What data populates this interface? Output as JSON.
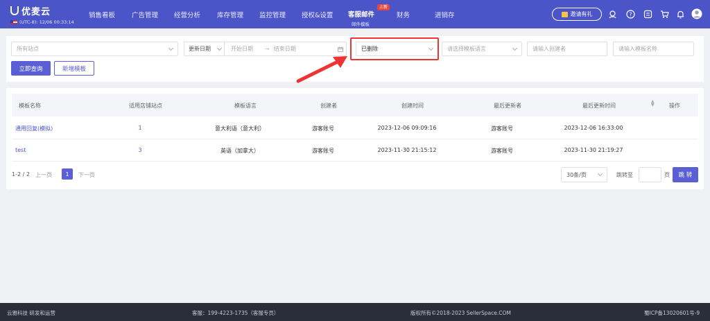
{
  "brand": {
    "name": "优麦云",
    "clock": "(UTC-8): 12/06 00:33:14"
  },
  "nav": {
    "items": [
      "销售看板",
      "广告管理",
      "经营分析",
      "库存管理",
      "监控管理",
      "授权&设置",
      "客服邮件",
      "财务",
      "进销存"
    ],
    "active_sub": "邮件模板",
    "new_badge": "上新",
    "invite": "邀请有礼"
  },
  "filters": {
    "site_placeholder": "所有站点",
    "date_type": "更新日期",
    "start_date": "开始日期",
    "end_date": "结束日期",
    "date_sep": "→",
    "status": "已删除",
    "language_placeholder": "请选择模板语言",
    "creator_placeholder": "请输入创建者",
    "template_name_placeholder": "请输入模板名称",
    "query_button": "立即查询",
    "add_button": "新增模板"
  },
  "table": {
    "columns": [
      "模板名称",
      "适用店铺站点",
      "模板语言",
      "创建者",
      "创建时间",
      "最后更新者",
      "最后更新时间",
      "操作"
    ],
    "rows": [
      {
        "name": "通用回复(模拟)",
        "sites": "1",
        "language": "意大利语（意大利）",
        "creator": "游客账号",
        "created": "2023-12-06 09:09:16",
        "updater": "游客账号",
        "updated": "2023-12-06 16:33:00"
      },
      {
        "name": "test",
        "sites": "3",
        "language": "英语（加拿大）",
        "creator": "游客账号",
        "created": "2023-11-30 21:15:12",
        "updater": "游客账号",
        "updated": "2023-11-30 21:19:27"
      }
    ]
  },
  "pagination": {
    "range": "1-2 / 2",
    "prev": "上一页",
    "current": "1",
    "next": "下一页",
    "page_size": "30条/页",
    "jump_label": "跳转至",
    "page_unit": "页",
    "go": "跳 转"
  },
  "footer": {
    "company": "云雅科技 研发和运营",
    "service": "客服：199-4223-1735（客服专员）",
    "copyright": "版权所有©2018-2023 SellerSpace.COM",
    "icp": "蜀ICP备13020601号-9"
  },
  "colors": {
    "primary": "#5b5fd6",
    "nav_bg": "#4b55c8",
    "highlight": "#ee3333",
    "footer_bg": "#2a2e3a"
  }
}
